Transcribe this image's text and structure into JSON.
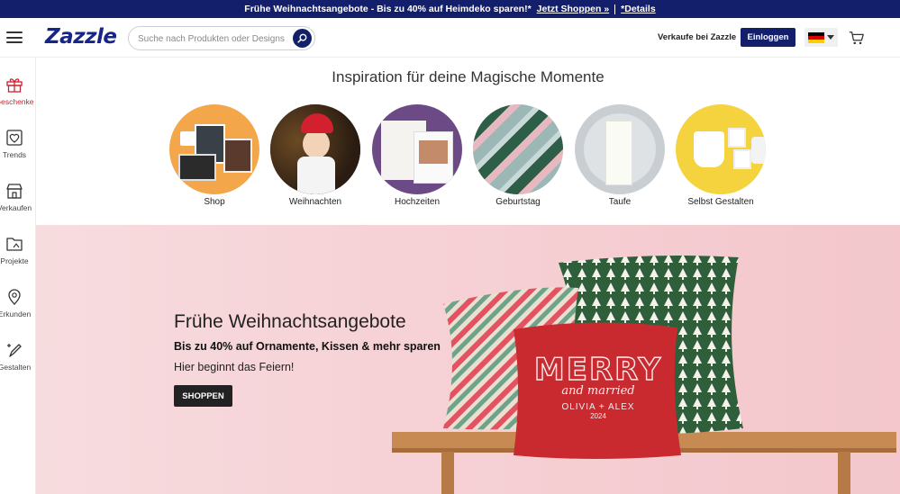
{
  "promo": {
    "text": "Frühe Weihnachtsangebote - Bis zu 40% auf Heimdeko sparen!*",
    "shop_link": "Jetzt Shoppen »",
    "details_link": "*Details"
  },
  "header": {
    "logo": "Zazzle",
    "search_placeholder": "Suche nach Produkten oder Designs",
    "sell_link": "Verkaufe bei Zazzle",
    "login_button": "Einloggen",
    "language_flag": "germany-flag-icon"
  },
  "sidebar": {
    "items": [
      {
        "label": "Geschenke",
        "icon": "gift-icon",
        "active": true
      },
      {
        "label": "Trends",
        "icon": "trends-icon",
        "active": false
      },
      {
        "label": "Verkaufen",
        "icon": "store-icon",
        "active": false
      },
      {
        "label": "Projekte",
        "icon": "folder-icon",
        "active": false
      },
      {
        "label": "Erkunden",
        "icon": "explore-icon",
        "active": false
      },
      {
        "label": "Gestalten",
        "icon": "design-pen-icon",
        "active": false
      }
    ]
  },
  "inspiration": {
    "title": "Inspiration für deine Magische Momente",
    "categories": [
      {
        "label": "Shop"
      },
      {
        "label": "Weihnachten"
      },
      {
        "label": "Hochzeiten"
      },
      {
        "label": "Geburtstag"
      },
      {
        "label": "Taufe"
      },
      {
        "label": "Selbst Gestalten"
      }
    ]
  },
  "hero": {
    "title": "Frühe Weihnachtsangebote",
    "subtitle": "Bis zu 40% auf Ornamente, Kissen & mehr sparen",
    "description": "Hier beginnt das Feiern!",
    "button": "SHOPPEN",
    "pillow_text_1": "MERRY",
    "pillow_text_2": "and married",
    "pillow_text_3": "OLIVIA + ALEX",
    "pillow_text_4": "2024"
  },
  "colors": {
    "brand_navy": "#131f6b",
    "accent_red": "#d2202f",
    "hero_pink": "#f6d2d6"
  }
}
